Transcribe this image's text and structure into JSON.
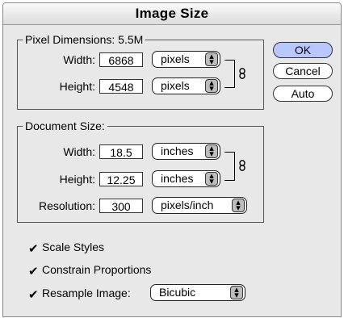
{
  "dialog": {
    "title": "Image Size"
  },
  "pixel_dimensions": {
    "legend": "Pixel Dimensions: 5.5M",
    "width_label": "Width:",
    "width_value": "6868",
    "width_unit": "pixels",
    "height_label": "Height:",
    "height_value": "4548",
    "height_unit": "pixels"
  },
  "document_size": {
    "legend": "Document Size:",
    "width_label": "Width:",
    "width_value": "18.5",
    "width_unit": "inches",
    "height_label": "Height:",
    "height_value": "12.25",
    "height_unit": "inches",
    "resolution_label": "Resolution:",
    "resolution_value": "300",
    "resolution_unit": "pixels/inch"
  },
  "buttons": {
    "ok": "OK",
    "cancel": "Cancel",
    "auto": "Auto"
  },
  "options": {
    "scale_styles": {
      "label": "Scale Styles",
      "checked": true
    },
    "constrain_proportions": {
      "label": "Constrain Proportions",
      "checked": true
    },
    "resample_image": {
      "label": "Resample Image:",
      "checked": true,
      "method": "Bicubic"
    }
  },
  "icons": {
    "link": "chain-link-icon",
    "popup_arrow": "updown-arrow-icon",
    "checkmark": "checkmark-icon"
  },
  "colors": {
    "default_button": "#b8c8ff",
    "dialog_bg": "#e8e8e8"
  }
}
